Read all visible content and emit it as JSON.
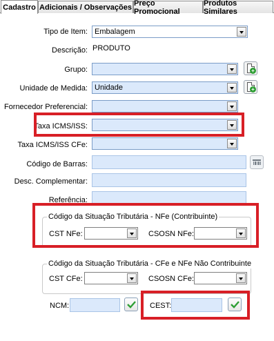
{
  "tabs": [
    {
      "label": "Cadastro"
    },
    {
      "label": "Adicionais / Observações"
    },
    {
      "label": "Preço Promocional"
    },
    {
      "label": "Produtos Similares"
    }
  ],
  "form": {
    "tipo_item": {
      "label": "Tipo de Item:",
      "value": "Embalagem"
    },
    "descricao": {
      "label": "Descrição:",
      "value": "PRODUTO"
    },
    "grupo": {
      "label": "Grupo:",
      "value": ""
    },
    "unidade": {
      "label": "Unidade de Medida:",
      "value": "Unidade"
    },
    "fornecedor": {
      "label": "Fornecedor Preferencial:",
      "value": ""
    },
    "taxa_icms": {
      "label": "Taxa ICMS/ISS:",
      "value": ""
    },
    "taxa_icms_cfe": {
      "label": "Taxa ICMS/ISS CFe:",
      "value": ""
    },
    "codigo_barras": {
      "label": "Código de Barras:",
      "value": ""
    },
    "desc_complementar": {
      "label": "Desc. Complementar:",
      "value": ""
    },
    "referencia": {
      "label": "Referência:",
      "value": ""
    }
  },
  "group_nfe": {
    "title": "Código da Situação Tributária - NFe (Contribuinte)",
    "cst_label": "CST NFe:",
    "cst_value": "",
    "csosn_label": "CSOSN NFe:",
    "csosn_value": ""
  },
  "group_cfe": {
    "title": "Código da Situação Tributária - CFe e NFe Não Contribuinte",
    "cst_label": "CST CFe:",
    "cst_value": "",
    "csosn_label": "CSOSN CFe:",
    "csosn_value": ""
  },
  "ncm": {
    "label": "NCM:",
    "value": ""
  },
  "cest": {
    "label": "CEST:",
    "value": ""
  },
  "colors": {
    "highlight": "#d81f26",
    "field_bg": "#dbe9fb",
    "ok_green": "#2e9e34"
  }
}
